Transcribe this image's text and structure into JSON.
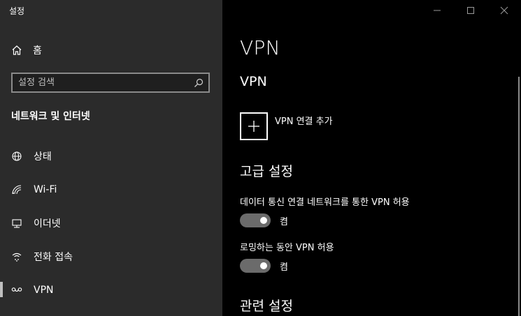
{
  "window": {
    "title": "설정",
    "controls": {
      "minimize_icon": "minimize-icon",
      "maximize_icon": "maximize-icon",
      "close_icon": "close-icon"
    }
  },
  "sidebar": {
    "home_label": "홈",
    "search_placeholder": "설정 검색",
    "section_title": "네트워크 및 인터넷",
    "items": [
      {
        "label": "상태",
        "icon": "globe-status-icon",
        "selected": false
      },
      {
        "label": "Wi-Fi",
        "icon": "wifi-icon",
        "selected": false
      },
      {
        "label": "이더넷",
        "icon": "ethernet-icon",
        "selected": false
      },
      {
        "label": "전화 접속",
        "icon": "dialup-icon",
        "selected": false
      },
      {
        "label": "VPN",
        "icon": "vpn-icon",
        "selected": true
      }
    ]
  },
  "main": {
    "page_title": "VPN",
    "vpn_heading": "VPN",
    "add_vpn_label": "VPN 연결 추가",
    "advanced_heading": "고급 설정",
    "settings": [
      {
        "label": "데이터 통신 연결 네트워크를 통한 VPN 허용",
        "state_label": "켬",
        "on": true
      },
      {
        "label": "로밍하는 동안 VPN 허용",
        "state_label": "켬",
        "on": true
      }
    ],
    "related_heading": "관련 설정"
  },
  "colors": {
    "sidebar_bg": "#2b2b2b",
    "main_bg": "#000000",
    "toggle_bg": "#6b6b6b",
    "text": "#ffffff"
  }
}
